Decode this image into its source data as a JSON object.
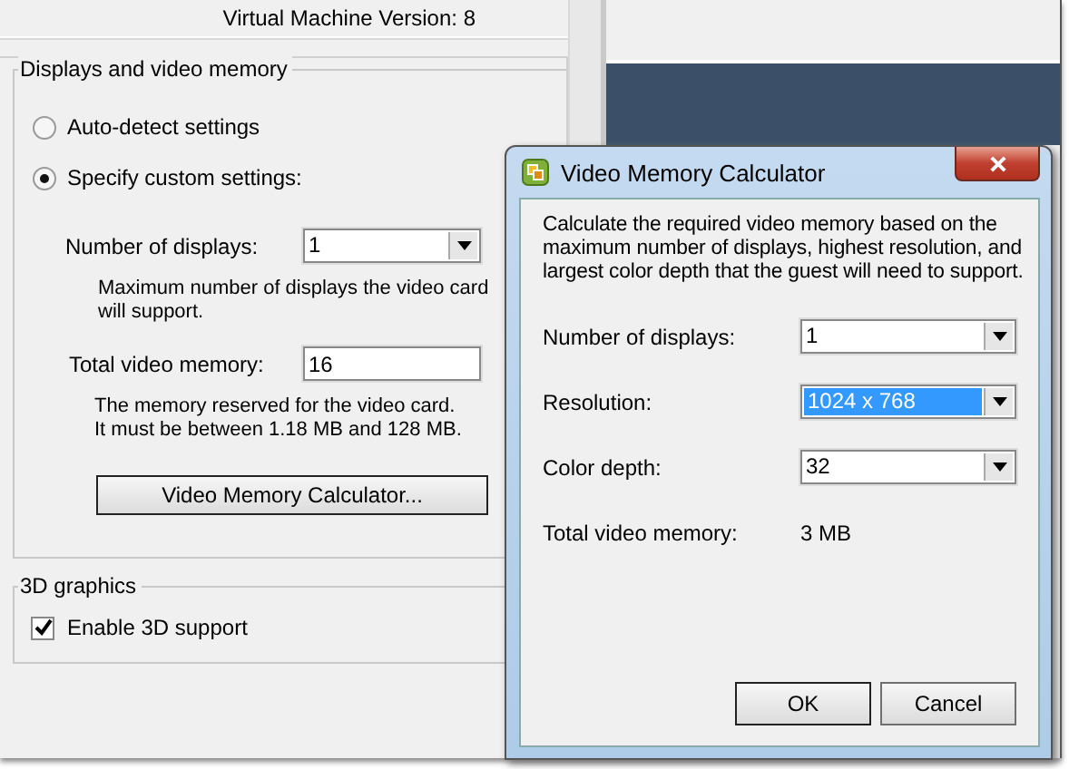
{
  "main_window": {
    "version_label": "Virtual Machine Version: 8",
    "displays_group": {
      "title": "Displays and video memory",
      "options": [
        {
          "label": "Auto-detect settings",
          "selected": false
        },
        {
          "label": "Specify custom settings:",
          "selected": true
        }
      ],
      "number_of_displays": {
        "label": "Number of displays:",
        "value": "1"
      },
      "displays_hint": "Maximum number of displays the video card will support.",
      "total_video_memory": {
        "label": "Total video memory:",
        "value": "16"
      },
      "memory_hint": "The memory reserved for the video card.\nIt must be between 1.18 MB and 128 MB.",
      "calculator_button": "Video Memory Calculator..."
    },
    "graphics_group": {
      "title": "3D graphics",
      "enable_3d": {
        "label": "Enable 3D support",
        "checked": true
      }
    }
  },
  "dialog": {
    "title": "Video Memory Calculator",
    "description": "Calculate the required video memory based on the maximum number of displays, highest resolution, and largest color depth that the guest will need to support.",
    "fields": [
      {
        "label": "Number of displays:",
        "value": "1",
        "selected": false
      },
      {
        "label": "Resolution:",
        "value": "1024 x 768",
        "selected": true
      },
      {
        "label": "Color depth:",
        "value": "32",
        "selected": false
      }
    ],
    "total": {
      "label": "Total video memory:",
      "value": "3 MB"
    },
    "buttons": [
      {
        "label": "OK",
        "default": true
      },
      {
        "label": "Cancel",
        "default": false
      }
    ]
  }
}
